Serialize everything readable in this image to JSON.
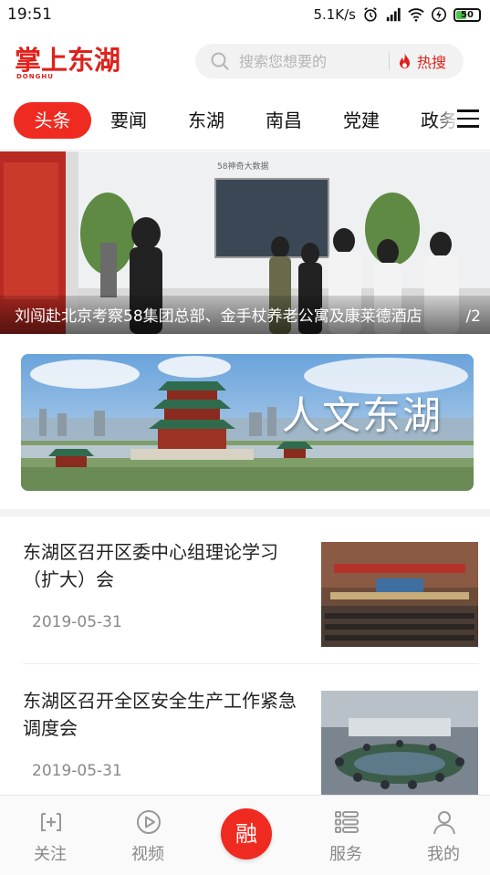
{
  "status_bar": {
    "time": "19:51",
    "network_speed": "5.1K/s",
    "battery": "50",
    "battery_level": 0.5
  },
  "header": {
    "logo_text": "掌上东湖",
    "logo_subtext": "DONGHU",
    "search_placeholder": "搜索您想要的",
    "hot_label": "热搜"
  },
  "tabs": [
    {
      "label": "头条",
      "active": true
    },
    {
      "label": "要闻",
      "active": false
    },
    {
      "label": "东湖",
      "active": false
    },
    {
      "label": "南昌",
      "active": false
    },
    {
      "label": "党建",
      "active": false
    },
    {
      "label": "政务",
      "active": false
    }
  ],
  "banner": {
    "caption": "刘闯赴北京考察58集团总部、金手杖养老公寓及康莱德酒店",
    "page_indicator": "/2",
    "screen_text": "58神奇大数据"
  },
  "feature": {
    "title": "人文东湖"
  },
  "news": [
    {
      "title": "东湖区召开区委中心组理论学习（扩大）会",
      "date": "2019-05-31"
    },
    {
      "title": "东湖区召开全区安全生产工作紧急调度会",
      "date": "2019-05-31"
    }
  ],
  "bottom_nav": {
    "follow": "关注",
    "video": "视频",
    "center": "融",
    "service": "服务",
    "mine": "我的"
  },
  "colors": {
    "brand_red": "#ef2a20",
    "logo_red": "#e0211b",
    "inactive_gray": "#888888"
  }
}
